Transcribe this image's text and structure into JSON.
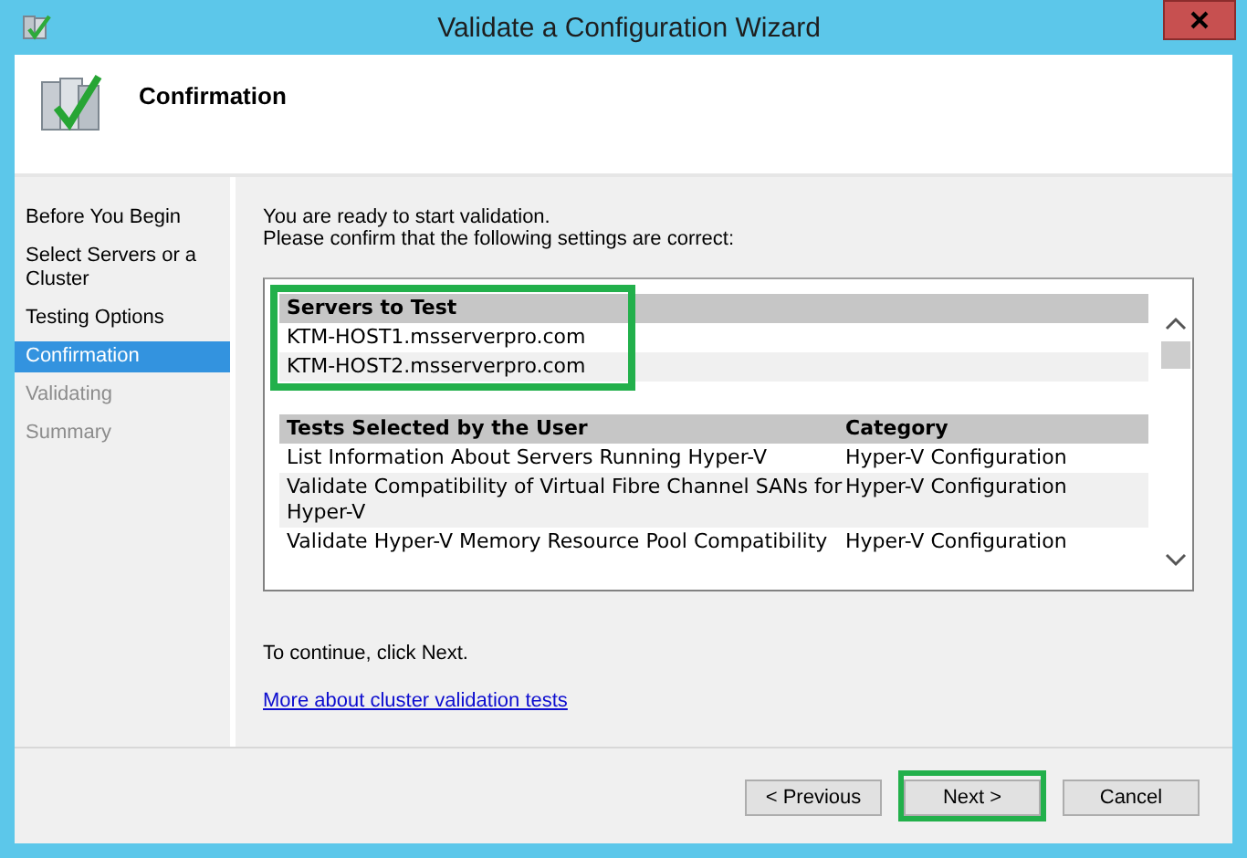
{
  "window": {
    "title": "Validate a Configuration Wizard"
  },
  "header": {
    "title": "Confirmation"
  },
  "sidebar": {
    "items": [
      {
        "label": "Before You Begin",
        "selected": false,
        "disabled": false
      },
      {
        "label": "Select Servers or a Cluster",
        "selected": false,
        "disabled": false
      },
      {
        "label": "Testing Options",
        "selected": false,
        "disabled": false
      },
      {
        "label": "Confirmation",
        "selected": true,
        "disabled": false
      },
      {
        "label": "Validating",
        "selected": false,
        "disabled": true
      },
      {
        "label": "Summary",
        "selected": false,
        "disabled": true
      }
    ]
  },
  "intro": [
    "You are ready to start validation.",
    "Please confirm that the following settings are correct:"
  ],
  "servers": {
    "heading": "Servers to Test",
    "highlighted": true,
    "rows": [
      "KTM-HOST1.msserverpro.com",
      "KTM-HOST2.msserverpro.com"
    ]
  },
  "tests": {
    "columns": [
      "Tests Selected by the User",
      "Category"
    ],
    "rows": [
      [
        "List Information About Servers Running Hyper-V",
        "Hyper-V Configuration"
      ],
      [
        "Validate Compatibility of Virtual Fibre Channel SANs for Hyper-V",
        "Hyper-V Configuration"
      ],
      [
        "Validate Hyper-V Memory Resource Pool Compatibility",
        "Hyper-V Configuration"
      ]
    ]
  },
  "continue_text": "To continue, click Next.",
  "link": "More about cluster validation tests",
  "buttons": [
    {
      "label": "< Previous",
      "highlighted": false
    },
    {
      "label": "Next >",
      "highlighted": true
    },
    {
      "label": "Cancel",
      "highlighted": false
    }
  ]
}
